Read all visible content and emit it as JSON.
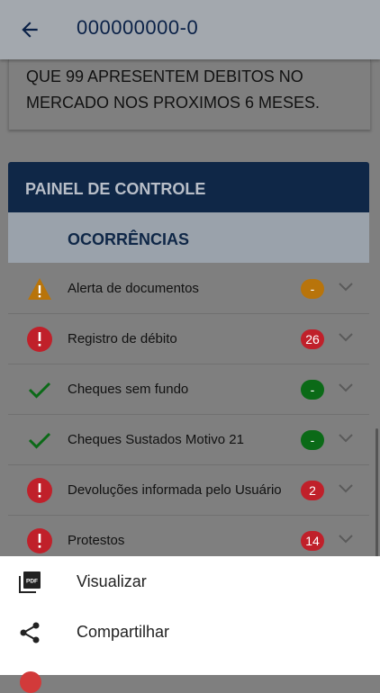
{
  "header": {
    "title": "000000000-0"
  },
  "message": {
    "text": "QUE 99 APRESENTEM DEBITOS NO MERCADO NOS PROXIMOS 6 MESES."
  },
  "panel": {
    "title": "PAINEL DE CONTROLE",
    "section_title": "OCORRÊNCIAS",
    "items": [
      {
        "label": "Alerta de documentos",
        "badge": "-",
        "icon": "warning-icon",
        "badge_color": "#b8740b"
      },
      {
        "label": "Registro de débito",
        "badge": "26",
        "icon": "error-icon",
        "badge_color": "#c0202a"
      },
      {
        "label": "Cheques sem fundo",
        "badge": "-",
        "icon": "check-icon",
        "badge_color": "#0b6a17"
      },
      {
        "label": "Cheques Sustados Motivo 21",
        "badge": "-",
        "icon": "check-icon",
        "badge_color": "#0b6a17"
      },
      {
        "label": "Devoluções informada pelo Usuário",
        "badge": "2",
        "icon": "error-icon",
        "badge_color": "#c0202a"
      },
      {
        "label": "Protestos",
        "badge": "14",
        "icon": "error-icon",
        "badge_color": "#c0202a"
      }
    ]
  },
  "sheet": {
    "items": [
      {
        "label": "Visualizar",
        "icon": "pdf-icon"
      },
      {
        "label": "Compartilhar",
        "icon": "share-icon"
      }
    ]
  },
  "colors": {
    "navy": "#0f2747",
    "error": "#c0202a",
    "success": "#0b6a17",
    "warning": "#b8740b"
  }
}
